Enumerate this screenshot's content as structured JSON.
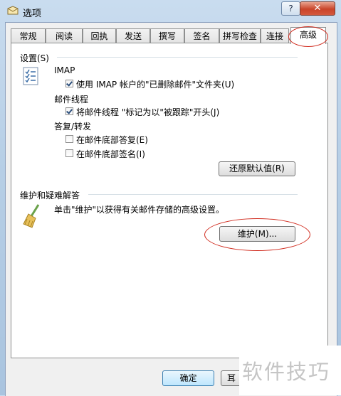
{
  "window": {
    "title": "选项",
    "help_glyph": "?",
    "close_glyph": "✕"
  },
  "tabs": [
    {
      "label": "常规"
    },
    {
      "label": "阅读"
    },
    {
      "label": "回执"
    },
    {
      "label": "发送"
    },
    {
      "label": "撰写"
    },
    {
      "label": "签名"
    },
    {
      "label": "拼写检查"
    },
    {
      "label": "连接"
    },
    {
      "label": "高级",
      "active": true
    }
  ],
  "settings": {
    "header": "设置(S)",
    "imap": {
      "heading": "IMAP",
      "option": "使用 IMAP 帐户的\"已删除邮件\"文件夹(U)",
      "checked": true
    },
    "threads": {
      "heading": "邮件线程",
      "option": "将邮件线程 \"标记为以\"被跟踪\"开头(J)",
      "checked": true
    },
    "reply": {
      "heading": "答复/转发",
      "options": [
        {
          "label": "在邮件底部答复(E)",
          "checked": false
        },
        {
          "label": "在邮件底部签名(I)",
          "checked": false
        }
      ]
    },
    "restore_button": "还原默认值(R)"
  },
  "maintenance": {
    "header": "维护和疑难解答",
    "description": "单击\"维护\"以获得有关邮件存储的高级设置。",
    "button": "维护(M)..."
  },
  "footer": {
    "ok": "确定",
    "partial": "耳"
  },
  "watermark": "软件技巧",
  "colors": {
    "highlight_ellipse": "#d0291c",
    "accent": "#3c7fb1"
  }
}
